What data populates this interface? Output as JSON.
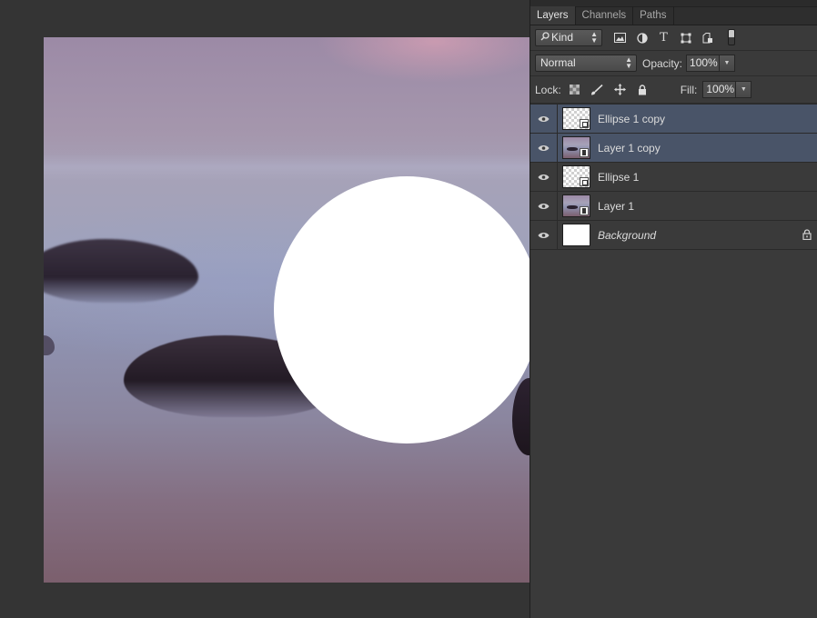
{
  "panel": {
    "tabs": [
      {
        "label": "Layers",
        "active": true
      },
      {
        "label": "Channels",
        "active": false
      },
      {
        "label": "Paths",
        "active": false
      }
    ],
    "filter": {
      "kind_label": "Kind",
      "icons": [
        "image-filter-icon",
        "adjustment-filter-icon",
        "type-filter-icon",
        "shape-filter-icon",
        "smart-object-filter-icon"
      ]
    },
    "blend": {
      "mode": "Normal",
      "opacity_label": "Opacity:",
      "opacity_value": "100%"
    },
    "lock": {
      "label": "Lock:",
      "icons": [
        "lock-transparency-icon",
        "lock-pixels-icon",
        "lock-position-icon",
        "lock-all-icon"
      ],
      "fill_label": "Fill:",
      "fill_value": "100%"
    },
    "layers": [
      {
        "name": "Ellipse 1 copy",
        "thumb": "shape",
        "selected": true
      },
      {
        "name": "Layer 1 copy",
        "thumb": "smart",
        "selected": true
      },
      {
        "name": "Ellipse 1",
        "thumb": "shape",
        "selected": false
      },
      {
        "name": "Layer 1",
        "thumb": "smart",
        "selected": false
      },
      {
        "name": "Background",
        "thumb": "white",
        "selected": false,
        "locked": true
      }
    ]
  },
  "colors": {
    "selection": "#495468",
    "panel_bg": "#3a3a3a",
    "workspace_bg": "#343434",
    "ellipse_fill": "#ffffff"
  }
}
